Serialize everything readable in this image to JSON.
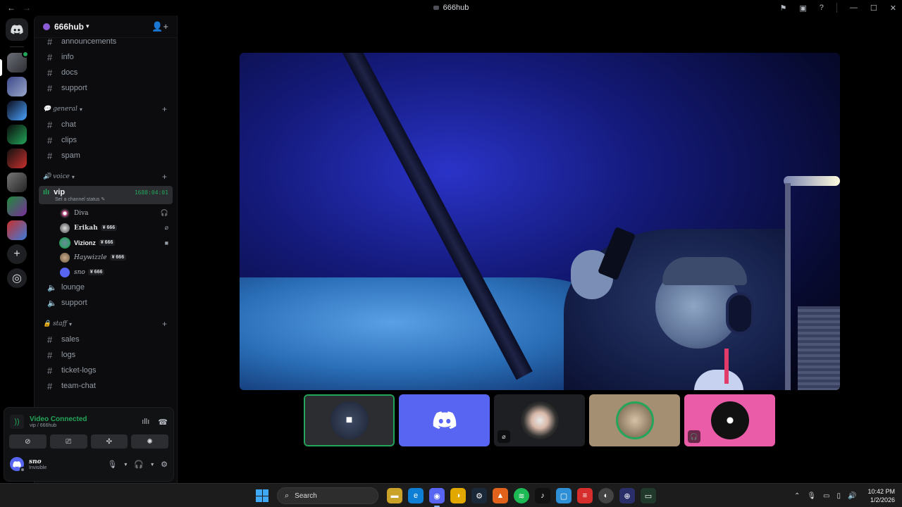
{
  "window": {
    "title": "666hub"
  },
  "server": {
    "name": "666hub"
  },
  "channels_top": [
    {
      "name": "announcements"
    },
    {
      "name": "info"
    },
    {
      "name": "docs"
    },
    {
      "name": "support"
    }
  ],
  "categories": {
    "general": {
      "label": "💬 general",
      "channels": [
        "chat",
        "clips",
        "spam"
      ]
    },
    "voice": {
      "label": "🔊 voice"
    },
    "staff": {
      "label": "🔒 staff",
      "channels": [
        "sales",
        "logs",
        "ticket-logs",
        "team-chat"
      ]
    }
  },
  "vip": {
    "name": "vip",
    "timer": "1688:04:01",
    "status_placeholder": "Set a channel status ✎"
  },
  "voice_users": [
    {
      "name": "Diva",
      "tag": "",
      "status_icon": "headphones-muted-icon"
    },
    {
      "name": "Erikah",
      "tag": "¥ 666",
      "status_icon": "mic-muted-icon"
    },
    {
      "name": "Vizionz",
      "tag": "¥ 666",
      "status_icon": "video-icon"
    },
    {
      "name": "Haywizzle",
      "tag": "¥ 666",
      "status_icon": ""
    },
    {
      "name": "sno",
      "tag": "¥ 666",
      "status_icon": ""
    }
  ],
  "voice_channels": [
    "lounge",
    "support"
  ],
  "voice_status": {
    "title": "Video Connected",
    "subtitle": "vip / 666hub"
  },
  "user": {
    "name": "sno",
    "status": "Invisible"
  },
  "taskbar": {
    "search_placeholder": "Search",
    "time": "10:42 PM",
    "date": "1/2/2026"
  },
  "colors": {
    "accent_green": "#23a55a",
    "blurple": "#5865f2",
    "danger": "#f23f43"
  }
}
